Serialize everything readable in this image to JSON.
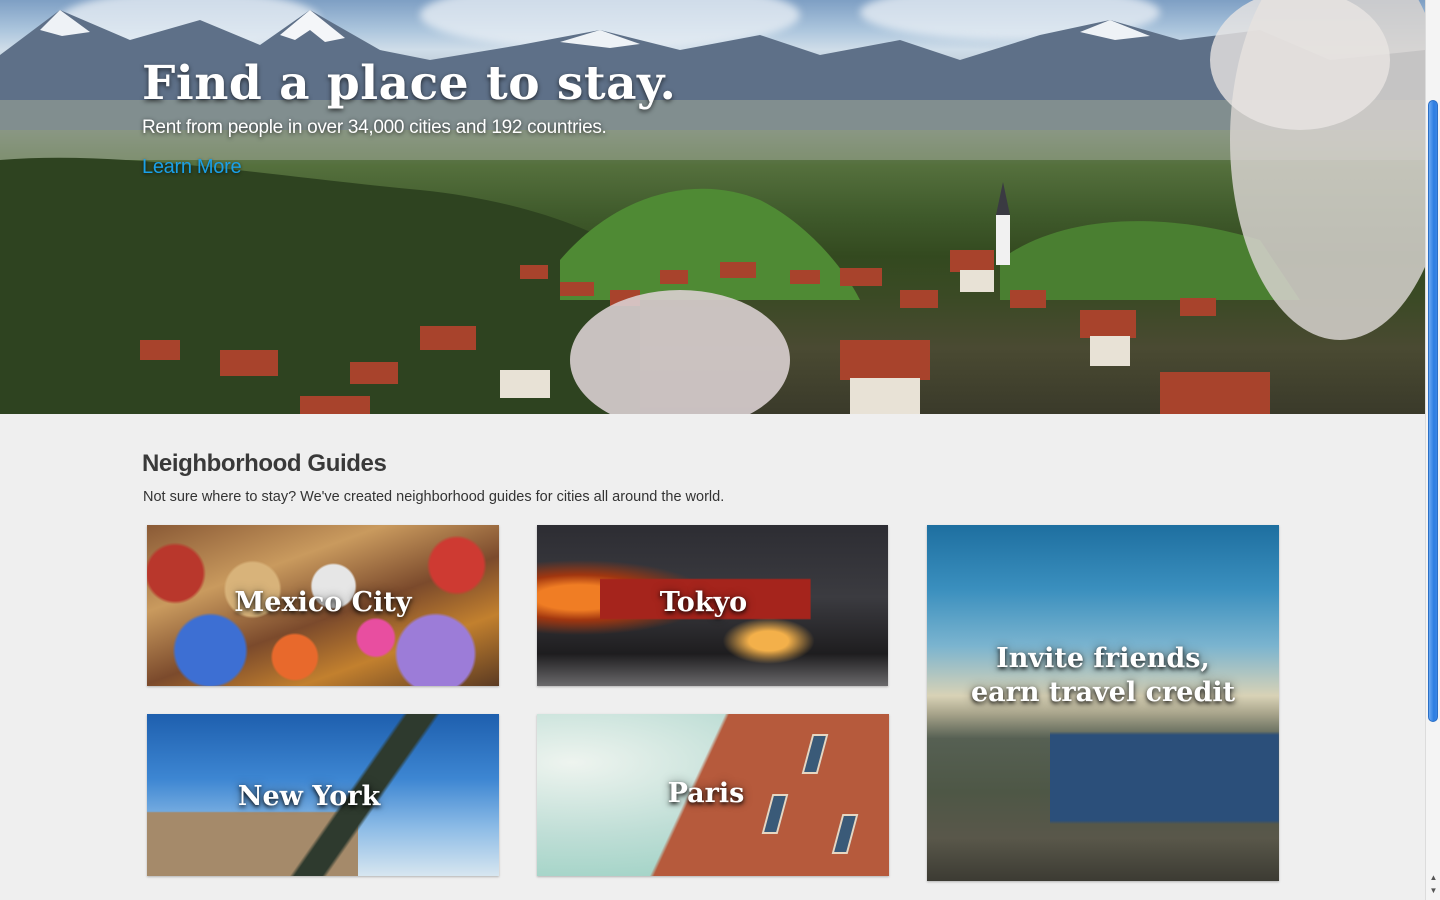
{
  "hero": {
    "title": "Find a place to stay.",
    "subtitle": "Rent from people in over 34,000 cities and 192 countries.",
    "link_label": "Learn More"
  },
  "guides": {
    "title": "Neighborhood Guides",
    "description": "Not sure where to stay? We've created neighborhood guides for cities all around the world.",
    "cards": [
      {
        "label": "Mexico City"
      },
      {
        "label": "Tokyo"
      },
      {
        "label": "Invite friends,",
        "label2": "earn travel credit"
      },
      {
        "label": "New York"
      },
      {
        "label": "Paris"
      }
    ]
  },
  "colors": {
    "link": "#1aa0e8",
    "page_background": "#efefef",
    "heading_text": "#393939"
  },
  "icons": {
    "scroll_up": "scroll-up-arrow-icon",
    "scroll_down": "scroll-down-arrow-icon"
  }
}
